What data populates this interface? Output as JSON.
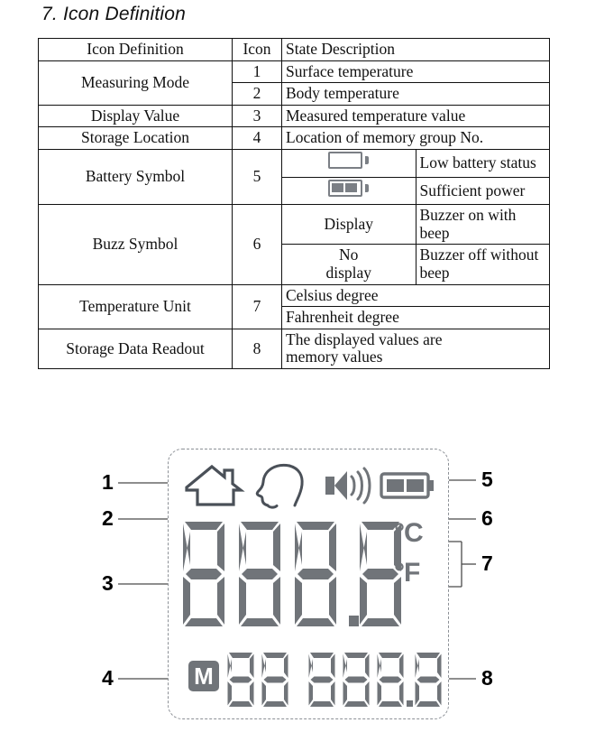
{
  "heading": "7. Icon Definition",
  "table": {
    "header": [
      "Icon Definition",
      "Icon",
      "State Description"
    ],
    "rows": [
      {
        "name": "Measuring Mode",
        "num": "1",
        "desc": "Surface temperature"
      },
      {
        "name": "",
        "num": "2",
        "desc": "Body temperature"
      },
      {
        "name": "Display Value",
        "num": "3",
        "desc": "Measured temperature value"
      },
      {
        "name": "Storage Location",
        "num": "4",
        "desc": "Location of memory group No."
      },
      {
        "name": "Battery Symbol",
        "num": "5",
        "sub": "battery-empty-icon",
        "desc": "Low battery status"
      },
      {
        "name": "",
        "num": "",
        "sub": "battery-full-icon",
        "desc": "Sufficient power"
      },
      {
        "name": "Buzz Symbol",
        "num": "6",
        "sub": "Display",
        "desc": "Buzzer on with beep"
      },
      {
        "name": "",
        "num": "",
        "sub": "No display",
        "desc": "Buzzer off without beep"
      },
      {
        "name": "Temperature Unit",
        "num": "7",
        "desc": "Celsius  degree"
      },
      {
        "name": "",
        "num": "",
        "desc": "Fahrenheit degree"
      },
      {
        "name": "Storage Data Readout",
        "num": "8",
        "desc": "The displayed values are memory values"
      }
    ],
    "sub_labels": {
      "display": "Display",
      "no_display_line1": "No",
      "no_display_line2": "display"
    },
    "storage_desc_line1": "The displayed values are",
    "storage_desc_line2": "memory values"
  },
  "lcd": {
    "icons": {
      "house": "house-icon",
      "head": "head-icon",
      "buzzer": "speaker-waves-icon",
      "battery": "battery-full-icon"
    },
    "main_value": "888.8",
    "unit_celsius": "°C",
    "unit_fahrenheit": "°F",
    "memory_badge": "M",
    "memory_index": "88",
    "memory_value": "888.8"
  },
  "callouts": [
    {
      "id": "1",
      "label": "1",
      "target": "house-icon"
    },
    {
      "id": "2",
      "label": "2",
      "target": "head-icon"
    },
    {
      "id": "3",
      "label": "3",
      "target": "main-readout"
    },
    {
      "id": "4",
      "label": "4",
      "target": "memory-badge"
    },
    {
      "id": "5",
      "label": "5",
      "target": "battery-icon"
    },
    {
      "id": "6",
      "label": "6",
      "target": "buzzer-icon"
    },
    {
      "id": "7",
      "label": "7",
      "target": "unit-stack"
    },
    {
      "id": "8",
      "label": "8",
      "target": "memory-value"
    }
  ],
  "colors": {
    "lcd_segment": "#707479",
    "lcd_outline": "#4a5058",
    "panel_border": "#8c9096",
    "table_border": "#111111"
  }
}
